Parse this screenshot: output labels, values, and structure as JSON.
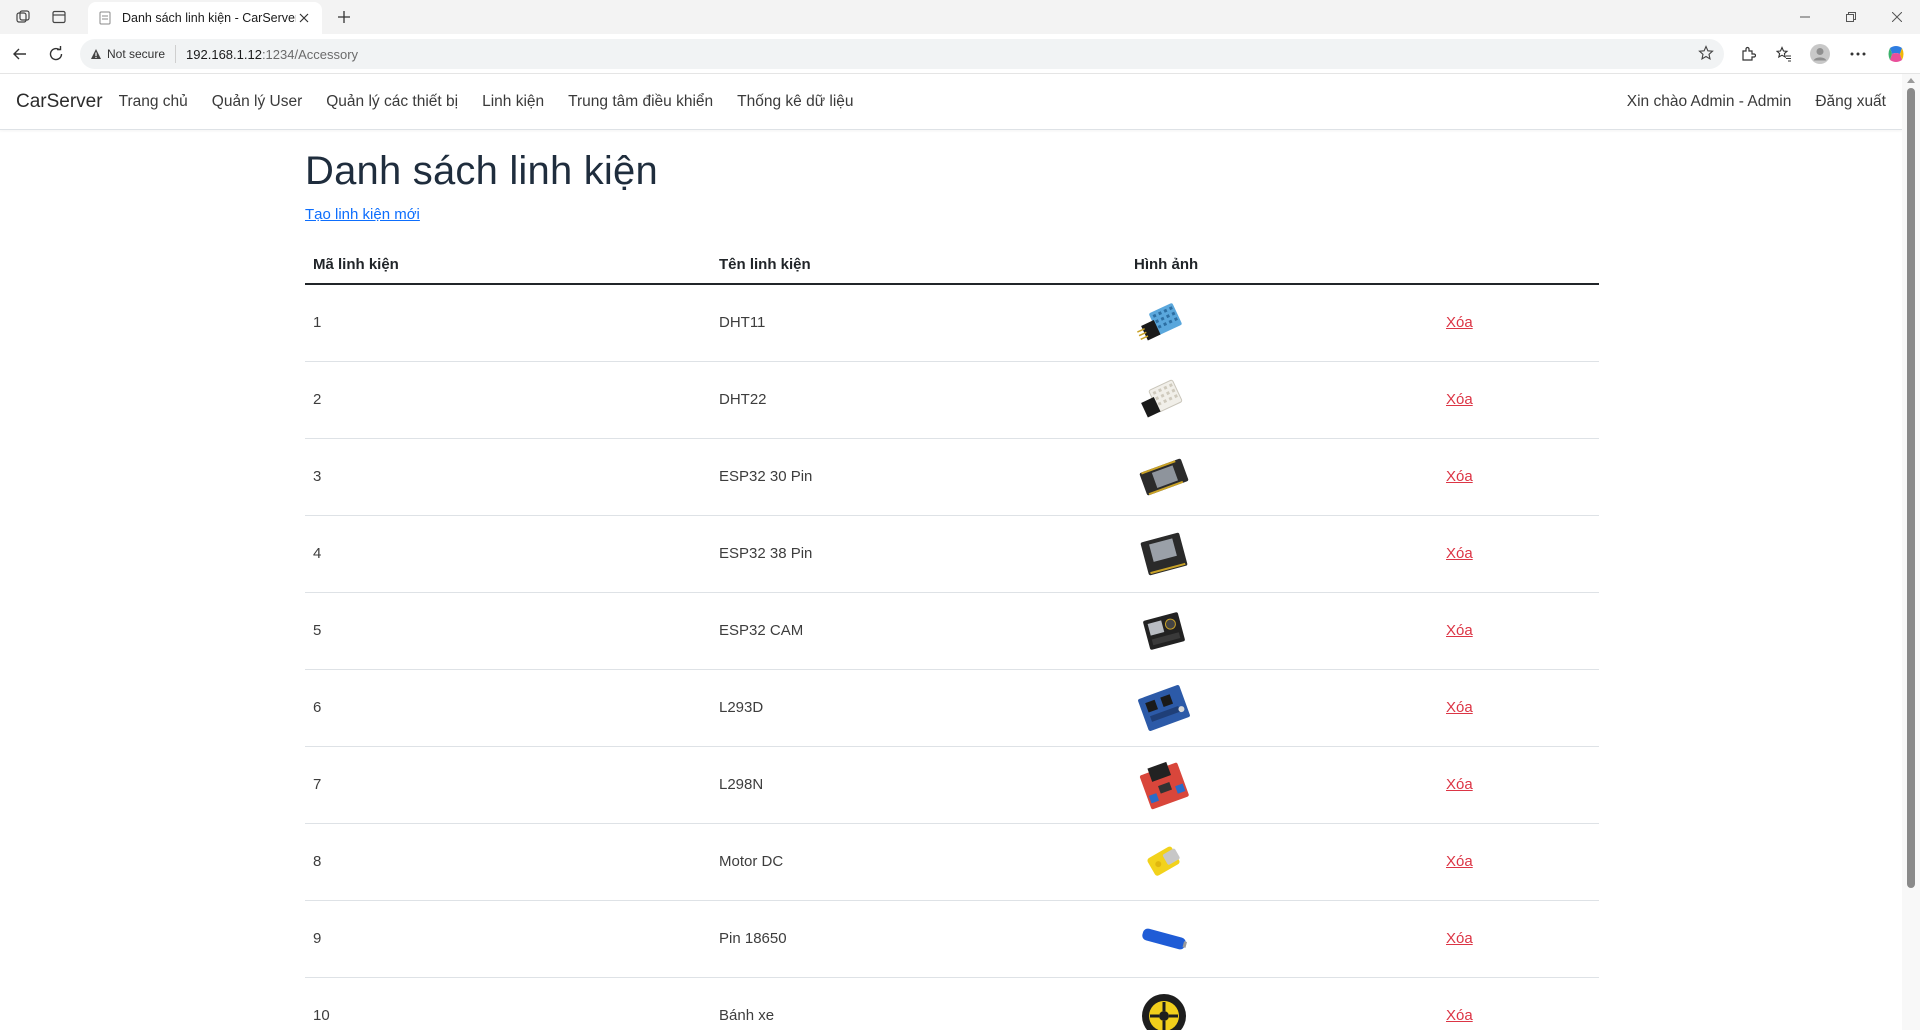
{
  "browser": {
    "tab_title": "Danh sách linh kiện - CarServer",
    "security_label": "Not secure",
    "url_host": "192.168.1.12",
    "url_path": ":1234/Accessory"
  },
  "navbar": {
    "brand": "CarServer",
    "links": [
      "Trang chủ",
      "Quản lý User",
      "Quản lý các thiết bị",
      "Linh kiện",
      "Trung tâm điều khiển",
      "Thống kê dữ liệu"
    ],
    "greeting": "Xin chào Admin - Admin",
    "logout": "Đăng xuất"
  },
  "page": {
    "title": "Danh sách linh kiện",
    "create_link": "Tạo linh kiện mới"
  },
  "table": {
    "headers": [
      "Mã linh kiện",
      "Tên linh kiện",
      "Hình ảnh",
      ""
    ],
    "rows": [
      {
        "id": "1",
        "name": "DHT11",
        "image": "dht11-sensor-image",
        "action": "Xóa"
      },
      {
        "id": "2",
        "name": "DHT22",
        "image": "dht22-sensor-image",
        "action": "Xóa"
      },
      {
        "id": "3",
        "name": "ESP32 30 Pin",
        "image": "esp32-30pin-image",
        "action": "Xóa"
      },
      {
        "id": "4",
        "name": "ESP32 38 Pin",
        "image": "esp32-38pin-image",
        "action": "Xóa"
      },
      {
        "id": "5",
        "name": "ESP32 CAM",
        "image": "esp32-cam-image",
        "action": "Xóa"
      },
      {
        "id": "6",
        "name": "L293D",
        "image": "l293d-shield-image",
        "action": "Xóa"
      },
      {
        "id": "7",
        "name": "L298N",
        "image": "l298n-driver-image",
        "action": "Xóa"
      },
      {
        "id": "8",
        "name": "Motor DC",
        "image": "motor-dc-image",
        "action": "Xóa"
      },
      {
        "id": "9",
        "name": "Pin 18650",
        "image": "battery-18650-image",
        "action": "Xóa"
      },
      {
        "id": "10",
        "name": "Bánh xe",
        "image": "wheel-image",
        "action": "Xóa"
      }
    ]
  },
  "colors": {
    "link": "#0d6efd",
    "delete": "#dc3545",
    "heading": "#1f2d3d"
  }
}
